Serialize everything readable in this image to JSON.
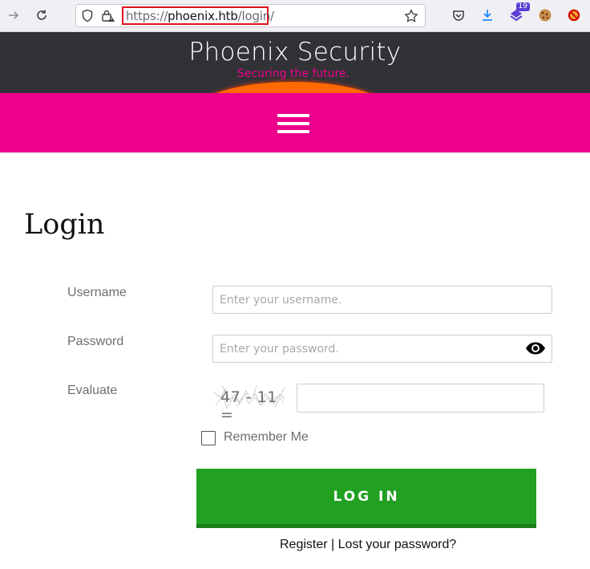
{
  "browser": {
    "url_prefix": "https://",
    "url_host": "phoenix.htb",
    "url_path": "/login/",
    "extension_badge": "19"
  },
  "site": {
    "title": "Phoenix Security",
    "tagline": "Securing the future."
  },
  "login": {
    "heading": "Login",
    "username_label": "Username",
    "username_placeholder": "Enter your username.",
    "password_label": "Password",
    "password_placeholder": "Enter your password.",
    "evaluate_label": "Evaluate",
    "captcha_text": "47 - 11 =",
    "remember_label": "Remember Me",
    "remember_checked": false,
    "submit_label": "LOG IN",
    "register_link": "Register",
    "separator": "|",
    "lost_password_link": "Lost your password?"
  },
  "colors": {
    "header_bg": "#323236",
    "nav_bg": "#ec008c",
    "tagline": "#ec008c",
    "button_bg": "#22a021",
    "url_highlight": "#e0121b"
  }
}
